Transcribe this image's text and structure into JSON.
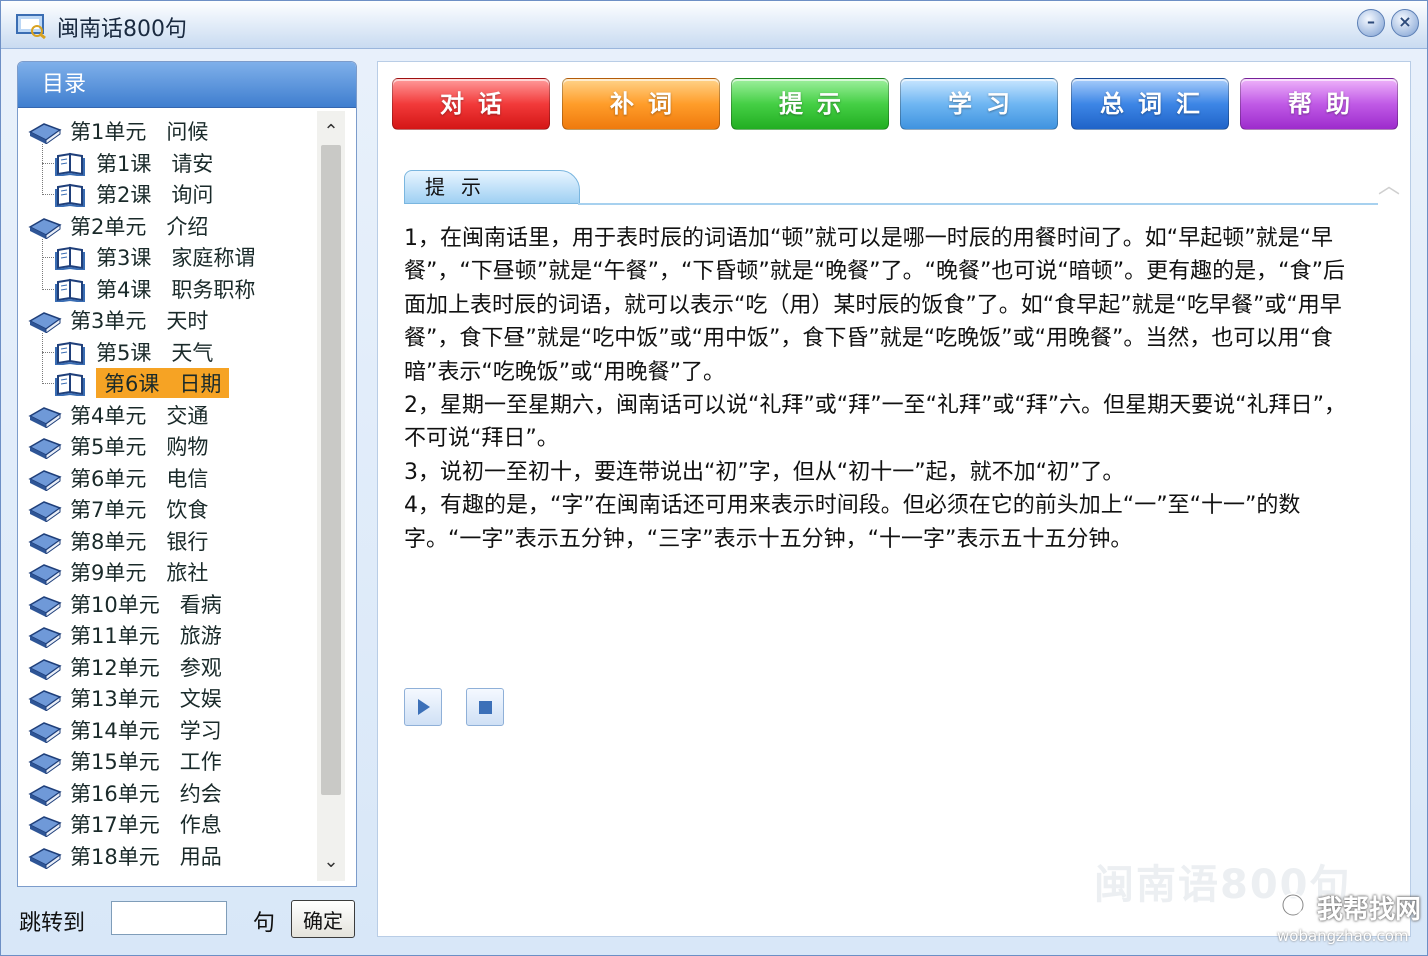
{
  "window": {
    "title": "闽南话800句",
    "minimize_label": "–",
    "close_label": "×"
  },
  "sidebar": {
    "header": "目录",
    "items": [
      {
        "level": 0,
        "col1": "第1单元",
        "col2": "问候"
      },
      {
        "level": 1,
        "col1": "第1课",
        "col2": "请安"
      },
      {
        "level": 1,
        "col1": "第2课",
        "col2": "询问"
      },
      {
        "level": 0,
        "col1": "第2单元",
        "col2": "介绍"
      },
      {
        "level": 1,
        "col1": "第3课",
        "col2": "家庭称谓"
      },
      {
        "level": 1,
        "col1": "第4课",
        "col2": "职务职称"
      },
      {
        "level": 0,
        "col1": "第3单元",
        "col2": "天时"
      },
      {
        "level": 1,
        "col1": "第5课",
        "col2": "天气"
      },
      {
        "level": 1,
        "col1": "第6课",
        "col2": "日期",
        "selected": true
      },
      {
        "level": 0,
        "col1": "第4单元",
        "col2": "交通"
      },
      {
        "level": 0,
        "col1": "第5单元",
        "col2": "购物"
      },
      {
        "level": 0,
        "col1": "第6单元",
        "col2": "电信"
      },
      {
        "level": 0,
        "col1": "第7单元",
        "col2": "饮食"
      },
      {
        "level": 0,
        "col1": "第8单元",
        "col2": "银行"
      },
      {
        "level": 0,
        "col1": "第9单元",
        "col2": "旅社"
      },
      {
        "level": 0,
        "col1": "第10单元",
        "col2": "看病"
      },
      {
        "level": 0,
        "col1": "第11单元",
        "col2": "旅游"
      },
      {
        "level": 0,
        "col1": "第12单元",
        "col2": "参观"
      },
      {
        "level": 0,
        "col1": "第13单元",
        "col2": "文娱"
      },
      {
        "level": 0,
        "col1": "第14单元",
        "col2": "学习"
      },
      {
        "level": 0,
        "col1": "第15单元",
        "col2": "工作"
      },
      {
        "level": 0,
        "col1": "第16单元",
        "col2": "约会"
      },
      {
        "level": 0,
        "col1": "第17单元",
        "col2": "作息"
      },
      {
        "level": 0,
        "col1": "第18单元",
        "col2": "用品"
      }
    ],
    "scroll_up": "⌃",
    "scroll_down": "⌄"
  },
  "jump": {
    "label": "跳转到",
    "value": "",
    "unit": "句",
    "confirm": "确定"
  },
  "toolbar": {
    "buttons": [
      "对话",
      "补词",
      "提示",
      "学习",
      "总词汇",
      "帮助"
    ]
  },
  "section": {
    "title": "提示",
    "paragraphs": [
      "1，在闽南话里，用于表时辰的词语加“顿”就可以是哪一时辰的用餐时间了。如“早起顿”就是“早餐”，“下昼顿”就是“午餐”，“下昏顿”就是“晚餐”了。“晚餐”也可说“暗顿”。更有趣的是，“食”后面加上表时辰的词语，就可以表示“吃（用）某时辰的饭食”了。如“食早起”就是“吃早餐”或“用早餐”，食下昼”就是“吃中饭”或“用中饭”，食下昏”就是“吃晚饭”或“用晚餐”。当然，也可以用“食暗”表示“吃晚饭”或“用晚餐”了。",
      "2，星期一至星期六，闽南话可以说“礼拜”或“拜”一至“礼拜”或“拜”六。但星期天要说“礼拜日”，不可说“拜日”。",
      "3，说初一至初十，要连带说出“初”字，但从“初十一”起，就不加“初”了。",
      "4，有趣的是，“字”在闽南话还可用来表示时间段。但必须在它的前头加上“一”至“十一”的数字。“一字”表示五分钟，“三字”表示十五分钟，“十一字”表示五十五分钟。"
    ]
  },
  "watermark": "闽南语800句",
  "site": {
    "name": "我帮找网",
    "url": "wobangzhao.com"
  },
  "colors": {
    "selected_bg": "#f6a324",
    "header_blue": "#3f7ecf"
  }
}
